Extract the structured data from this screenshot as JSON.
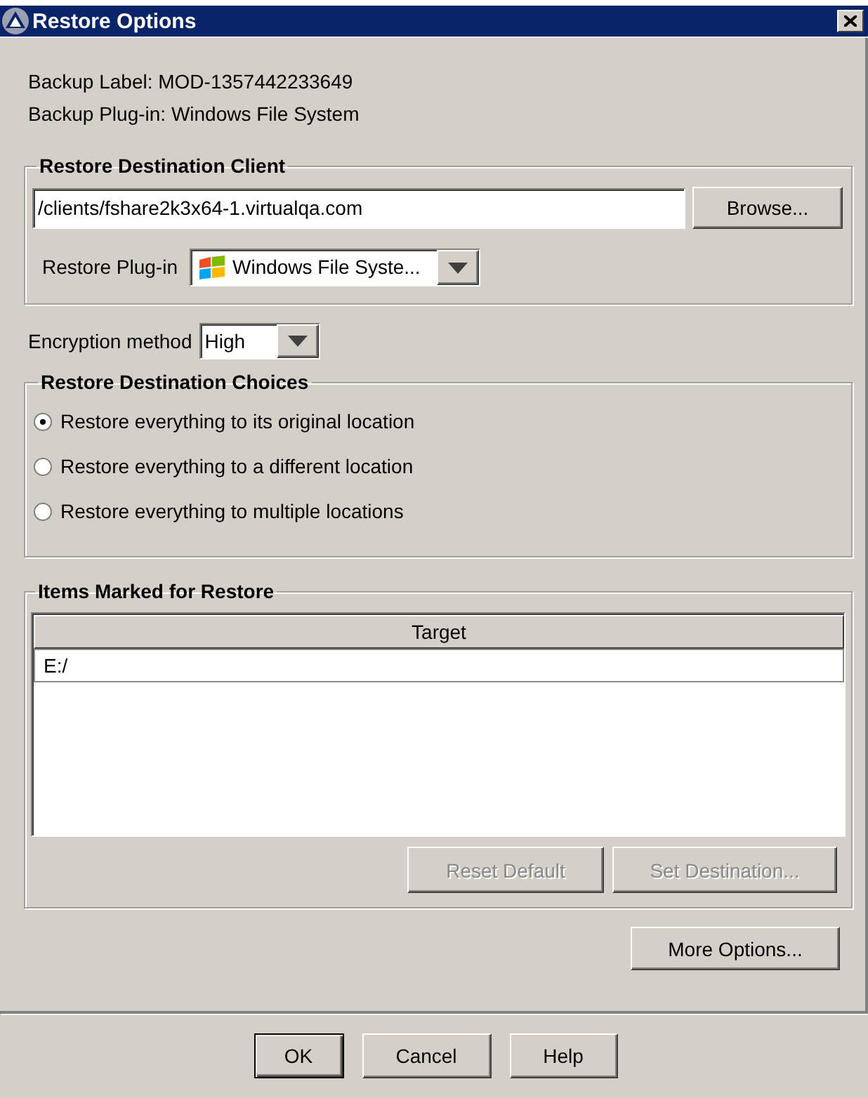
{
  "window": {
    "title": "Restore Options"
  },
  "info": [
    "Backup Label: MOD-1357442233649",
    "Backup Plug-in: Windows File System"
  ],
  "destination_client": {
    "title": "Restore Destination Client",
    "client_field": {
      "value": "/clients/fshare2k3x64-1.virtualqa.com"
    },
    "browse_button": "Browse...",
    "plugin": {
      "label": "Restore Plug-in",
      "value": "Windows File Syste..."
    }
  },
  "encryption": {
    "label": "Encryption method",
    "value": "High"
  },
  "destination_choices": {
    "title": "Restore Destination Choices",
    "options": [
      {
        "label": "Restore everything to its original location",
        "selected": true
      },
      {
        "label": "Restore everything to a different location",
        "selected": false
      },
      {
        "label": "Restore everything to multiple locations",
        "selected": false
      }
    ]
  },
  "items_marked": {
    "title": "Items Marked for Restore",
    "table": {
      "columns": [
        "Target"
      ],
      "rows": [
        [
          "E:/"
        ]
      ]
    },
    "buttons": [
      {
        "label": "Reset Default",
        "disabled": true
      },
      {
        "label": "Set Destination...",
        "disabled": true
      }
    ]
  },
  "more_options_button": "More Options...",
  "buttons": [
    {
      "label": "OK",
      "default": true
    },
    {
      "label": "Cancel",
      "default": false
    },
    {
      "label": "Help",
      "default": false
    }
  ]
}
